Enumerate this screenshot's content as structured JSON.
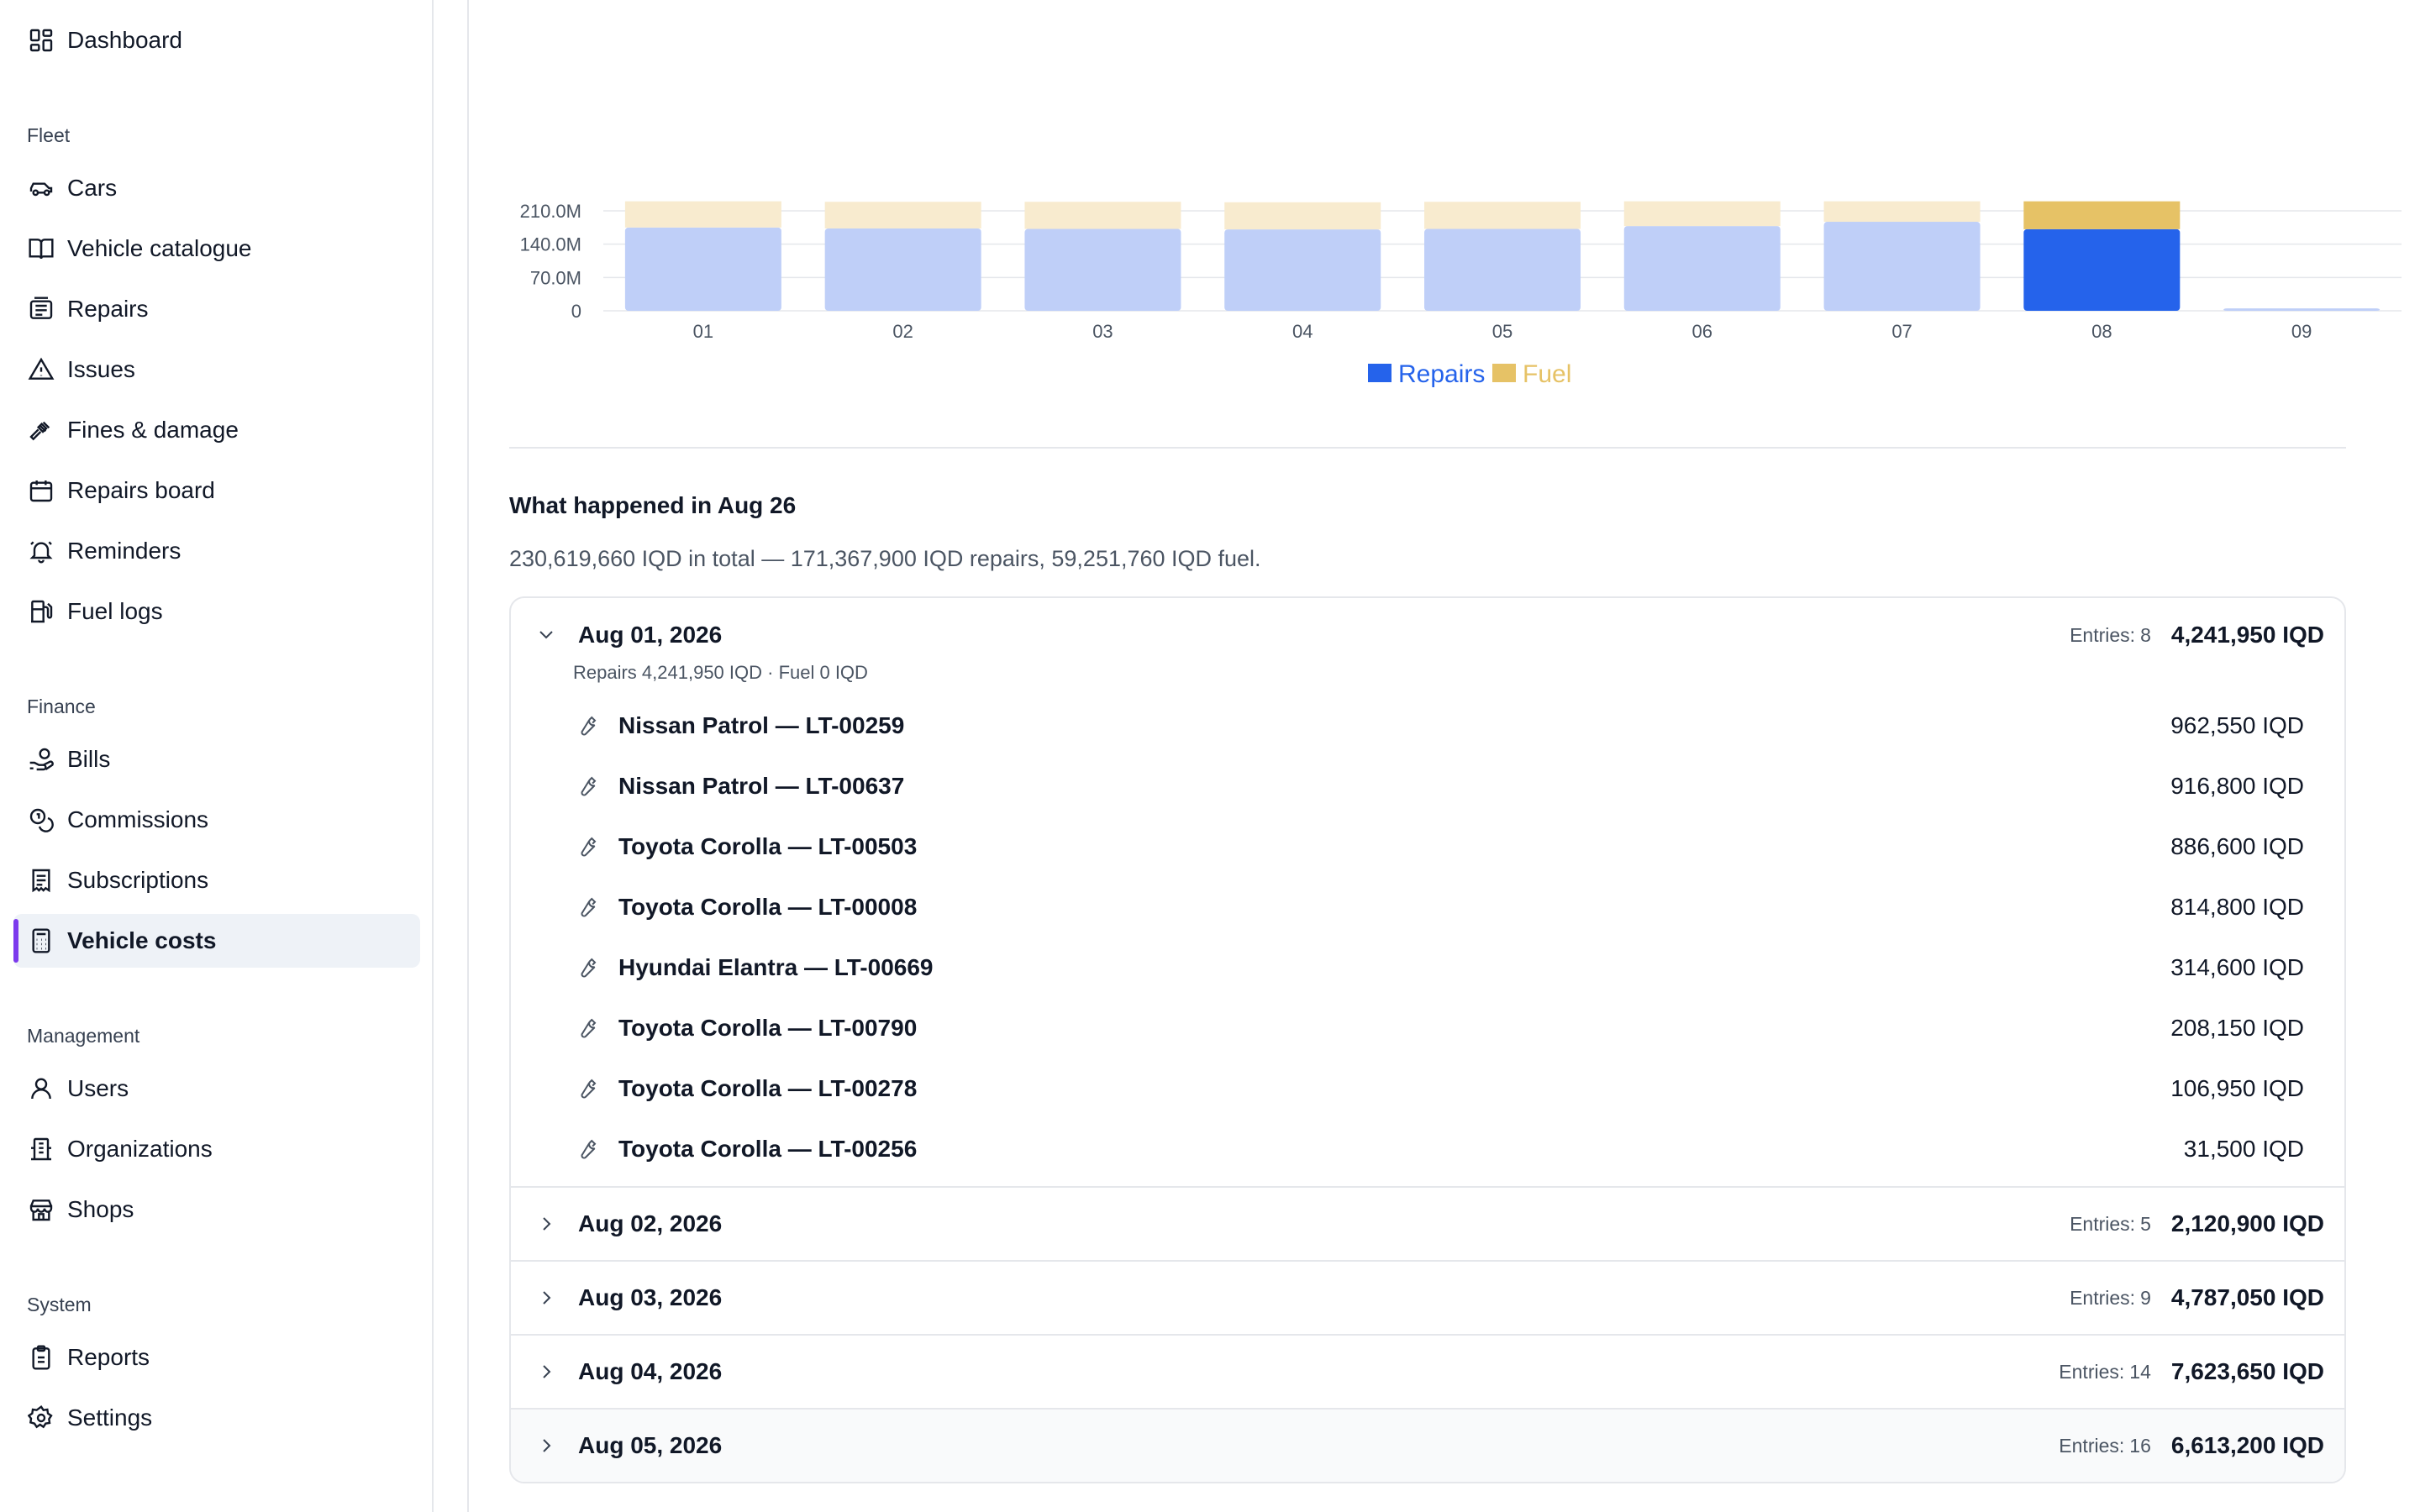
{
  "sidebar": {
    "top_items": [
      {
        "label": "Dashboard",
        "icon": "dashboard-icon"
      }
    ],
    "sections": [
      {
        "title": "Fleet",
        "items": [
          {
            "label": "Cars",
            "icon": "car-icon"
          },
          {
            "label": "Vehicle catalogue",
            "icon": "book-icon"
          },
          {
            "label": "Repairs",
            "icon": "repairs-icon"
          },
          {
            "label": "Issues",
            "icon": "warning-icon"
          },
          {
            "label": "Fines & damage",
            "icon": "gavel-icon"
          },
          {
            "label": "Repairs board",
            "icon": "calendar-icon"
          },
          {
            "label": "Reminders",
            "icon": "bell-icon"
          },
          {
            "label": "Fuel logs",
            "icon": "fuel-icon"
          }
        ]
      },
      {
        "title": "Finance",
        "items": [
          {
            "label": "Bills",
            "icon": "hand-coins-icon"
          },
          {
            "label": "Commissions",
            "icon": "coins-icon"
          },
          {
            "label": "Subscriptions",
            "icon": "receipt-icon"
          },
          {
            "label": "Vehicle costs",
            "icon": "calculator-icon",
            "active": true
          }
        ]
      },
      {
        "title": "Management",
        "items": [
          {
            "label": "Users",
            "icon": "user-icon"
          },
          {
            "label": "Organizations",
            "icon": "building-icon"
          },
          {
            "label": "Shops",
            "icon": "store-icon"
          }
        ]
      },
      {
        "title": "System",
        "items": [
          {
            "label": "Reports",
            "icon": "clipboard-icon"
          },
          {
            "label": "Settings",
            "icon": "gear-icon"
          }
        ]
      }
    ]
  },
  "chart_data": {
    "type": "bar",
    "stacked": true,
    "categories": [
      "01",
      "02",
      "03",
      "04",
      "05",
      "06",
      "07",
      "08",
      "09"
    ],
    "series": [
      {
        "name": "Repairs",
        "color": "#2563eb",
        "faded_color": "#bfcff8",
        "values": [
          175,
          173,
          172,
          171,
          172,
          178,
          187,
          171.4,
          5
        ]
      },
      {
        "name": "Fuel",
        "color": "#e6c266",
        "faded_color": "#f8ebcf",
        "values": [
          56,
          56,
          57,
          57,
          57,
          54,
          52,
          59.3,
          0
        ]
      }
    ],
    "highlight_index": 7,
    "y_ticks": [
      "0",
      "70.0M",
      "140.0M",
      "210.0M"
    ],
    "y_tick_values": [
      0,
      70,
      140,
      210
    ],
    "ylim": [
      0,
      210
    ],
    "legend": [
      "Repairs",
      "Fuel"
    ],
    "legend_position": "bottom",
    "grid": true
  },
  "summary": {
    "title": "What happened in Aug 26",
    "text": "230,619,660 IQD in total — 171,367,900 IQD repairs, 59,251,760 IQD fuel."
  },
  "entries_label": "Entries:",
  "days": [
    {
      "date": "Aug 01, 2026",
      "entries": "8",
      "total": "4,241,950 IQD",
      "expanded": true,
      "breakdown": "Repairs 4,241,950 IQD · Fuel 0 IQD",
      "items": [
        {
          "name": "Nissan Patrol — LT-00259",
          "amount": "962,550 IQD"
        },
        {
          "name": "Nissan Patrol — LT-00637",
          "amount": "916,800 IQD"
        },
        {
          "name": "Toyota Corolla — LT-00503",
          "amount": "886,600 IQD"
        },
        {
          "name": "Toyota Corolla — LT-00008",
          "amount": "814,800 IQD"
        },
        {
          "name": "Hyundai Elantra — LT-00669",
          "amount": "314,600 IQD"
        },
        {
          "name": "Toyota Corolla — LT-00790",
          "amount": "208,150 IQD"
        },
        {
          "name": "Toyota Corolla — LT-00278",
          "amount": "106,950 IQD"
        },
        {
          "name": "Toyota Corolla — LT-00256",
          "amount": "31,500 IQD"
        }
      ]
    },
    {
      "date": "Aug 02, 2026",
      "entries": "5",
      "total": "2,120,900 IQD",
      "expanded": false
    },
    {
      "date": "Aug 03, 2026",
      "entries": "9",
      "total": "4,787,050 IQD",
      "expanded": false
    },
    {
      "date": "Aug 04, 2026",
      "entries": "14",
      "total": "7,623,650 IQD",
      "expanded": false
    },
    {
      "date": "Aug 05, 2026",
      "entries": "16",
      "total": "6,613,200 IQD",
      "expanded": false
    }
  ]
}
